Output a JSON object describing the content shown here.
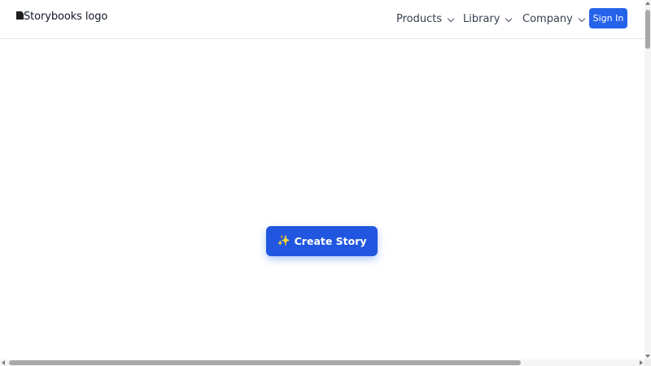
{
  "header": {
    "logo_alt": "Storybooks logo",
    "nav": [
      {
        "label": "Products"
      },
      {
        "label": "Library"
      },
      {
        "label": "Company"
      }
    ],
    "signin_label": "Sign In"
  },
  "main": {
    "create_icon": "✨",
    "create_label": "Create Story"
  },
  "colors": {
    "accent": "#2563eb",
    "button": "#2157e0",
    "border": "#e5e7eb"
  },
  "icons": {
    "nav_dropdown": "chevron-down-icon",
    "create": "sparkles-icon",
    "logo": "broken-image-icon"
  }
}
